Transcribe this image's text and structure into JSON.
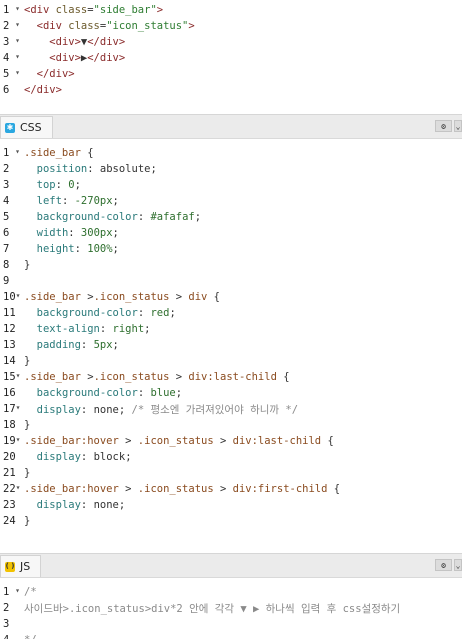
{
  "html_pane": {
    "lines": [
      {
        "n": "1",
        "fold": "▾"
      },
      {
        "n": "2",
        "fold": "▾"
      },
      {
        "n": "3",
        "fold": "▾"
      },
      {
        "n": "4",
        "fold": "▾"
      },
      {
        "n": "5",
        "fold": "▾"
      },
      {
        "n": "6",
        "fold": ""
      }
    ],
    "tokens": {
      "l1_open": "<div ",
      "l1_attr": "class",
      "l1_eq": "=",
      "l1_val": "\"side_bar\"",
      "l1_close": ">",
      "l2_open": "<div ",
      "l2_attr": "class",
      "l2_eq": "=",
      "l2_val": "\"icon_status\"",
      "l2_close": ">",
      "l3_open": "<div>",
      "l3_text": "▼",
      "l3_close": "</div>",
      "l4_open": "<div>",
      "l4_text": "▶",
      "l4_close": "</div>",
      "l5": "</div>",
      "l6": "</div>"
    }
  },
  "css_pane": {
    "tab_label": "CSS",
    "tab_icon": "css-icon",
    "gear_icon": "gear-icon",
    "lines": [
      {
        "n": "1",
        "fold": "▾"
      },
      {
        "n": "2",
        "fold": ""
      },
      {
        "n": "3",
        "fold": ""
      },
      {
        "n": "4",
        "fold": ""
      },
      {
        "n": "5",
        "fold": ""
      },
      {
        "n": "6",
        "fold": ""
      },
      {
        "n": "7",
        "fold": ""
      },
      {
        "n": "8",
        "fold": ""
      },
      {
        "n": "9",
        "fold": ""
      },
      {
        "n": "10",
        "fold": "▾"
      },
      {
        "n": "11",
        "fold": ""
      },
      {
        "n": "12",
        "fold": ""
      },
      {
        "n": "13",
        "fold": ""
      },
      {
        "n": "14",
        "fold": ""
      },
      {
        "n": "15",
        "fold": "▾"
      },
      {
        "n": "16",
        "fold": ""
      },
      {
        "n": "17",
        "fold": "▾"
      },
      {
        "n": "18",
        "fold": ""
      },
      {
        "n": "19",
        "fold": "▾"
      },
      {
        "n": "20",
        "fold": ""
      },
      {
        "n": "21",
        "fold": ""
      },
      {
        "n": "22",
        "fold": "▾"
      },
      {
        "n": "23",
        "fold": ""
      },
      {
        "n": "24",
        "fold": ""
      }
    ],
    "tokens": {
      "l1_sel": ".side_bar",
      "l1_brace": " {",
      "l2_prop": "position",
      "l2_val": "absolute",
      "l3_prop": "top",
      "l3_val": "0",
      "l4_prop": "left",
      "l4_val": "-270px",
      "l5_prop": "background-color",
      "l5_val": "#afafaf",
      "l6_prop": "width",
      "l6_val": "300px",
      "l7_prop": "height",
      "l7_val": "100%",
      "l8": "}",
      "l10_sel_a": ".side_bar",
      "l10_comb1": " >",
      "l10_sel_b": ".icon_status",
      "l10_comb2": " > ",
      "l10_sel_c": "div",
      "l10_brace": " {",
      "l11_prop": "background-color",
      "l11_val": "red",
      "l12_prop": "text-align",
      "l12_val": "right",
      "l13_prop": "padding",
      "l13_val": "5px",
      "l14": "}",
      "l15_sel_a": ".side_bar",
      "l15_comb1": " >",
      "l15_sel_b": ".icon_status",
      "l15_comb2": " > ",
      "l15_sel_c": "div:last-child",
      "l15_brace": " {",
      "l16_prop": "background-color",
      "l16_val": "blue",
      "l17_prop": "display",
      "l17_val": "none",
      "l17_comment": " /* 평소엔 가려져있어야 하니까 */",
      "l18": "}",
      "l19_sel_a": ".side_bar:hover",
      "l19_comb1": " > ",
      "l19_sel_b": ".icon_status",
      "l19_comb2": " > ",
      "l19_sel_c": "div:last-child",
      "l19_brace": " {",
      "l20_prop": "display",
      "l20_val": "block",
      "l21": "}",
      "l22_sel_a": ".side_bar:hover",
      "l22_comb1": " > ",
      "l22_sel_b": ".icon_status",
      "l22_comb2": " > ",
      "l22_sel_c": "div:first-child",
      "l22_brace": " {",
      "l23_prop": "display",
      "l23_val": "none",
      "l24": "}"
    }
  },
  "js_pane": {
    "tab_label": "JS",
    "tab_icon": "js-icon",
    "gear_icon": "gear-icon",
    "lines": [
      {
        "n": "1",
        "fold": "▾"
      },
      {
        "n": "2",
        "fold": ""
      },
      {
        "n": "3",
        "fold": ""
      },
      {
        "n": "4",
        "fold": ""
      }
    ],
    "tokens": {
      "l1": "/*",
      "l2": "사이드바>.icon_status>div*2 안에 각각 ▼ ▶ 하나씩 입력 후 css설정하기",
      "l3": "",
      "l4": "*/"
    }
  }
}
